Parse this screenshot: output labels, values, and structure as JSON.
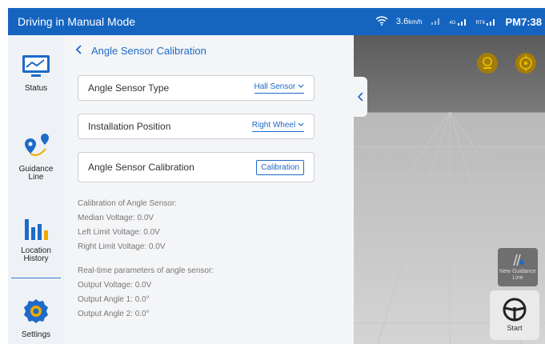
{
  "topbar": {
    "title": "Driving in Manual Mode",
    "speed": "3.6",
    "speed_unit": "km/h",
    "signal1_label": "4G",
    "signal2_label": "RTK",
    "time": "PM7:38"
  },
  "sidebar": {
    "items": [
      {
        "label": "Status",
        "icon": "monitor-chart-icon"
      },
      {
        "label": "Guidance Line",
        "icon": "route-pins-icon"
      },
      {
        "label": "Location History",
        "icon": "bar-chart-icon"
      },
      {
        "label": "Settings",
        "icon": "gear-icon"
      }
    ]
  },
  "panel": {
    "title": "Angle Sensor Calibration",
    "rows": [
      {
        "label": "Angle Sensor Type",
        "value": "Hall Sensor"
      },
      {
        "label": "Installation Position",
        "value": "Right Wheel"
      },
      {
        "label": "Angle Sensor Calibration",
        "button": "Calibration"
      }
    ],
    "calib_title": "Calibration of Angle Sensor:",
    "calib_lines": [
      "Median Voltage: 0.0V",
      "Left Limit Voltage: 0.0V",
      "Right Limit Voltage: 0.0V"
    ],
    "realtime_title": "Real-time parameters of angle sensor:",
    "realtime_lines": [
      "Output Voltage: 0.0V",
      "Output Angle 1: 0.0°",
      "Output Angle 2: 0.0°"
    ]
  },
  "map": {
    "new_guidance_label": "New Guidance Line",
    "start_label": "Start"
  },
  "colors": {
    "accent": "#1565c0",
    "link": "#1e6ac8",
    "gold": "#a27d0c"
  }
}
